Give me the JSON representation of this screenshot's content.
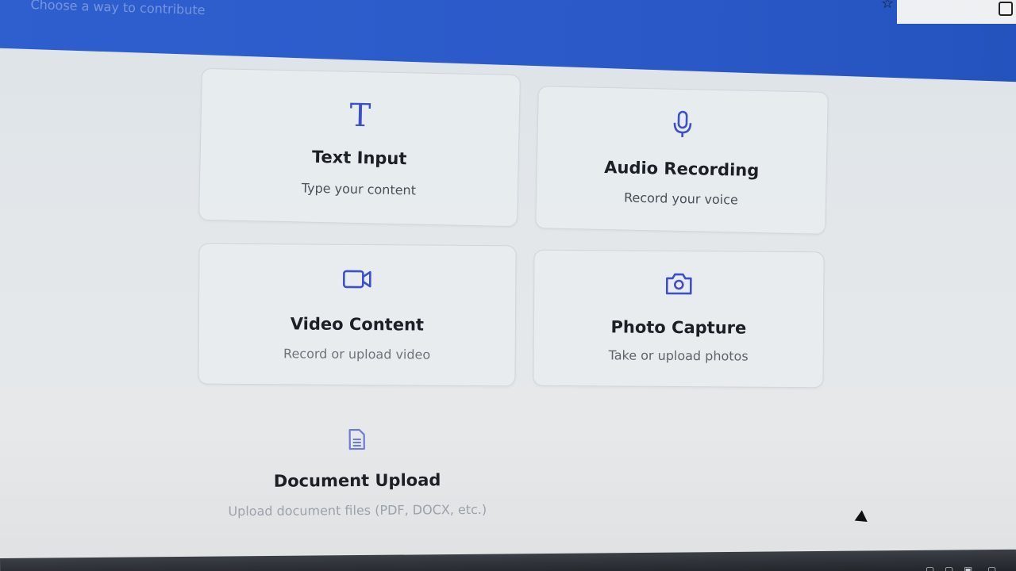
{
  "header": {
    "subtitle": "Choose a way to contribute"
  },
  "cards": {
    "text": {
      "icon": "T",
      "title": "Text Input",
      "desc": "Type your content"
    },
    "audio": {
      "title": "Audio Recording",
      "desc": "Record your voice"
    },
    "video": {
      "title": "Video Content",
      "desc": "Record or upload video"
    },
    "photo": {
      "title": "Photo Capture",
      "desc": "Take or upload photos"
    },
    "document": {
      "title": "Document Upload",
      "desc": "Upload document files (PDF, DOCX, etc.)"
    }
  },
  "colors": {
    "accent": "#3f4fc9",
    "header_blue": "#2b59c8"
  },
  "icons": [
    "text-icon",
    "microphone-icon",
    "video-camera-icon",
    "camera-icon",
    "document-icon",
    "star-icon",
    "shield-icon"
  ]
}
